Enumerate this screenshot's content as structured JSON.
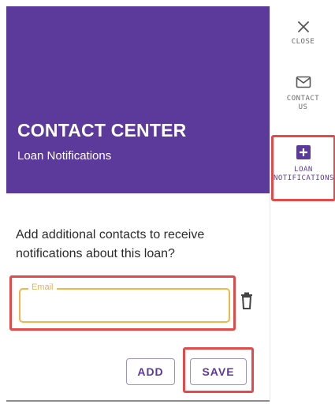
{
  "header": {
    "title": "CONTACT CENTER",
    "subtitle": "Loan Notifications"
  },
  "content": {
    "prompt": "Add additional contacts to receive notifications about this loan?",
    "email_label": "Email",
    "email_value": ""
  },
  "buttons": {
    "add": "ADD",
    "save": "SAVE"
  },
  "rail": {
    "close": "CLOSE",
    "contact": "CONTACT\nUS",
    "loan": "LOAN\nNOTIFICATIONS"
  },
  "colors": {
    "brand": "#5b3a9c",
    "highlight": "#e34a4a",
    "field_focus": "#f0b64a"
  },
  "icons": {
    "close": "close-icon",
    "mail": "mail-icon",
    "add_box": "add-box-icon",
    "delete": "trash-icon"
  }
}
